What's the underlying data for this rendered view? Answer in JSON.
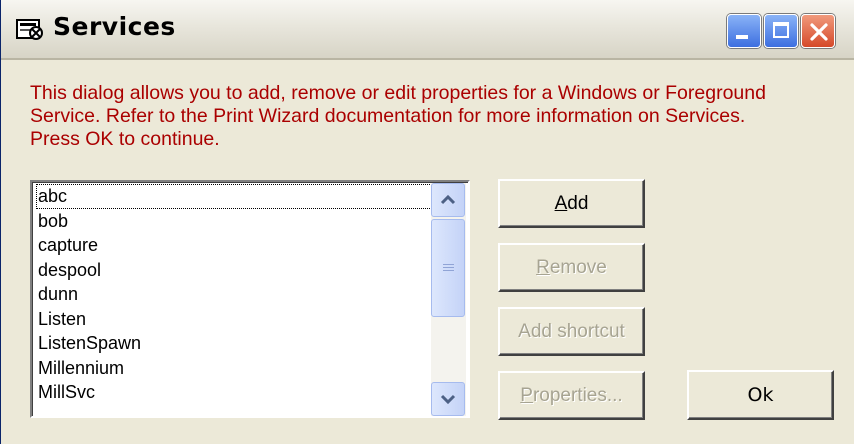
{
  "window": {
    "title": "Services",
    "icon": "services-app-icon",
    "controls": {
      "minimize": "minimize-icon",
      "maximize": "maximize-icon",
      "close": "close-icon"
    }
  },
  "description": {
    "line1": "This dialog allows you to add, remove or edit properties for a Windows or Foreground",
    "line2": "Service. Refer to the Print Wizard documentation for more information on Services.",
    "line3": "Press OK to continue.",
    "color": "#aa0000"
  },
  "services_list": {
    "items": [
      "abc",
      "bob",
      "capture",
      "despool",
      "dunn",
      "Listen",
      "ListenSpawn",
      "Millennium",
      "MillSvc"
    ],
    "focused_item": "abc"
  },
  "buttons": {
    "add": {
      "mnemonic": "A",
      "rest": "dd",
      "enabled": true
    },
    "remove": {
      "mnemonic": "R",
      "rest": "emove",
      "enabled": false
    },
    "add_shortcut": {
      "label": "Add shortcut",
      "enabled": false
    },
    "properties": {
      "mnemonic": "P",
      "rest": "roperties...",
      "enabled": false
    },
    "ok": {
      "label": "Ok",
      "enabled": true
    }
  }
}
